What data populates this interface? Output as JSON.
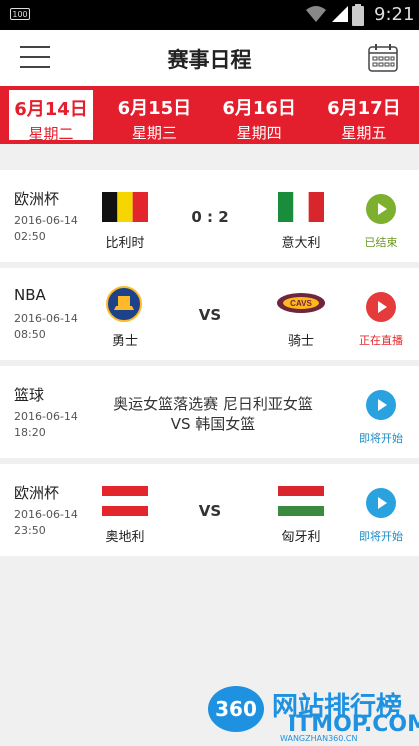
{
  "status_bar": {
    "battery_left": "100",
    "time": "9:21"
  },
  "header": {
    "title": "赛事日程",
    "menu_icon": "hamburger-icon",
    "calendar_icon": "calendar-icon"
  },
  "date_tabs": [
    {
      "date": "6月14日",
      "weekday": "星期二",
      "active": true
    },
    {
      "date": "6月15日",
      "weekday": "星期三",
      "active": false
    },
    {
      "date": "6月16日",
      "weekday": "星期四",
      "active": false
    },
    {
      "date": "6月17日",
      "weekday": "星期五",
      "active": false
    }
  ],
  "matches": [
    {
      "league": "欧洲杯",
      "date": "2016-06-14",
      "time": "02:50",
      "home": "比利时",
      "away": "意大利",
      "score": "0 : 2",
      "status": "已结束",
      "status_color": "#6a9a20"
    },
    {
      "league": "NBA",
      "date": "2016-06-14",
      "time": "08:50",
      "home": "勇士",
      "away": "骑士",
      "score": "VS",
      "status": "正在直播",
      "status_color": "#e0292c"
    },
    {
      "league": "篮球",
      "date": "2016-06-14",
      "time": "18:20",
      "event_line1": "奥运女篮落选赛 尼日利亚女篮",
      "event_line2": "VS 韩国女篮",
      "status": "即将开始",
      "status_color": "#1e8cc7"
    },
    {
      "league": "欧洲杯",
      "date": "2016-06-14",
      "time": "23:50",
      "home": "奥地利",
      "away": "匈牙利",
      "score": "VS",
      "status": "即将开始",
      "status_color": "#1e8cc7"
    }
  ],
  "watermark": {
    "badge": "360",
    "cn": "网站排行榜",
    "en": "ITMOP.COM",
    "url": "WANGZHAN360.CN"
  },
  "colors": {
    "accent": "#e31e2d"
  }
}
